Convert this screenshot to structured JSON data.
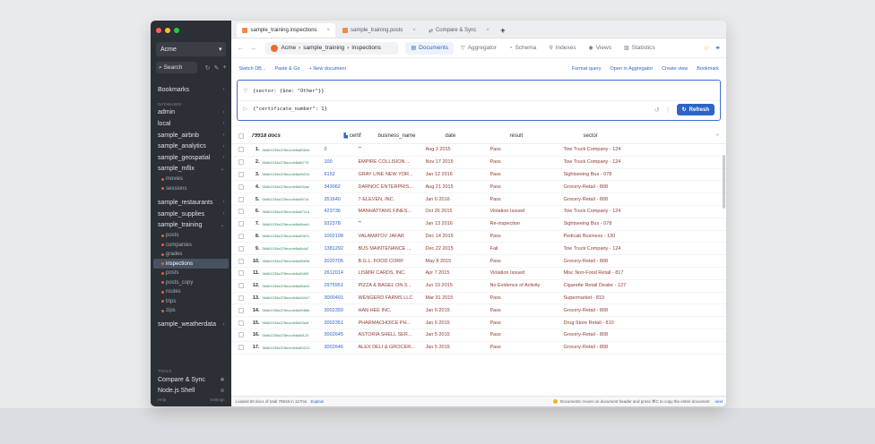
{
  "window": {
    "traffic_colors": [
      "#ff5f57",
      "#febc2e",
      "#28c840"
    ]
  },
  "sidebar": {
    "project": "Acme",
    "search_label": "Search",
    "bookmarks_label": "Bookmarks",
    "databases_label": "DATABASES",
    "tools_label": "TOOLS",
    "footer_help": "Help",
    "footer_settings": "Settings",
    "tree": [
      {
        "label": "admin",
        "children": []
      },
      {
        "label": "local",
        "children": []
      },
      {
        "label": "sample_airbnb",
        "children": []
      },
      {
        "label": "sample_analytics",
        "children": []
      },
      {
        "label": "sample_geospatial",
        "children": []
      },
      {
        "label": "sample_mflix",
        "children": [
          "movies",
          "sessions"
        ]
      },
      {
        "label": "sample_restaurants",
        "children": []
      },
      {
        "label": "sample_supplies",
        "children": []
      },
      {
        "label": "sample_training",
        "children": [
          "posts",
          "companies",
          "grades",
          "inspections",
          "posts",
          "posts_copy",
          "routes",
          "trips",
          "zips"
        ]
      },
      {
        "label": "sample_weatherdata",
        "children": []
      }
    ],
    "active_child": "inspections",
    "tools": [
      "Compare & Sync",
      "Node.js Shell"
    ]
  },
  "tabs": [
    {
      "label": "sample_training.inspections",
      "active": true
    },
    {
      "label": "sample_training.posts",
      "active": false
    },
    {
      "label": "Compare & Sync",
      "active": false
    }
  ],
  "breadcrumb": {
    "project": "Acme",
    "db": "sample_training",
    "collection": "inspections"
  },
  "view_tabs": [
    {
      "label": "Documents",
      "active": true
    },
    {
      "label": "Aggregator",
      "active": false
    },
    {
      "label": "Schema",
      "active": false
    },
    {
      "label": "Indexes",
      "active": false
    },
    {
      "label": "Views",
      "active": false
    },
    {
      "label": "Statistics",
      "active": false
    }
  ],
  "actions_left": [
    "Switch DB...",
    "Paste & Go",
    "+ New document"
  ],
  "actions_right": [
    "Format query",
    "Open in Aggregator",
    "Create view",
    "Bookmark"
  ],
  "query": {
    "filter": "{sector: {$ne: \"Other\"}}",
    "projection": "{\"certificate_number\": 1}",
    "refresh_label": "Refresh"
  },
  "table": {
    "docs_count": "79918 docs",
    "columns": [
      "certif",
      "business_name",
      "date",
      "result",
      "sector"
    ],
    "rows": [
      {
        "n": "1.",
        "id": "56d61033a378eccde8a8083e",
        "cert": "0",
        "name": "\"\"",
        "date": "Aug 3 2015",
        "result": "Pass",
        "sector": "Tow Truck Company - 124"
      },
      {
        "n": "2.",
        "id": "56d61033a378eccde8a8f775",
        "cert": "100",
        "name": "EMPIRE COLLISION ...",
        "date": "Nov 17 2015",
        "result": "Pass",
        "sector": "Tow Truck Company - 124"
      },
      {
        "n": "3.",
        "id": "56d61033a378eccde8a96231",
        "cert": "6152",
        "name": "GRAY LINE NEW YOR...",
        "date": "Jan 12 2016",
        "result": "Pass",
        "sector": "Sightseeing Bus - 078"
      },
      {
        "n": "4.",
        "id": "56d61033a378eccde8a93cac",
        "cert": "343062",
        "name": "DARNOC ENTERPRIS...",
        "date": "Aug 21 2015",
        "result": "Pass",
        "sector": "Grocery-Retail - 808"
      },
      {
        "n": "5.",
        "id": "56d61034a378eccde8a9674f",
        "cert": "351640",
        "name": "7-ELEVEN, INC.",
        "date": "Jan 6 2016",
        "result": "Pass",
        "sector": "Grocery-Retail - 808"
      },
      {
        "n": "6.",
        "id": "56d61033a378eccde8a8711d",
        "cert": "423736",
        "name": "MANHATTANS FINES...",
        "date": "Oct 26 2015",
        "result": "Violation Issued",
        "sector": "Tow Truck Company - 124"
      },
      {
        "n": "7.",
        "id": "56d61033a378eccde8a9bed1",
        "cert": "932378",
        "name": "\"\"",
        "date": "Jan 13 2016",
        "result": "Re-inspection",
        "sector": "Sightseeing Bus - 078"
      },
      {
        "n": "8.",
        "id": "56d61033a378eccde8a8987c",
        "cert": "1002198",
        "name": "VALAMATOV JAFAR",
        "date": "Dec 14 2015",
        "result": "Pass",
        "sector": "Pedicab Business - 130"
      },
      {
        "n": "9.",
        "id": "56d61034a378eccde8a8cfa2",
        "cert": "1381292",
        "name": "BUS MAINTENANCE ...",
        "date": "Dec 22 2015",
        "result": "Fail",
        "sector": "Tow Truck Company - 124"
      },
      {
        "n": "10.",
        "id": "56d61033a378eccde8a85836",
        "cert": "2020705",
        "name": "B.G.L. FOOD CORP.",
        "date": "May 8 2015",
        "result": "Pass",
        "sector": "Grocery-Retail - 808"
      },
      {
        "n": "11.",
        "id": "56d61033a378eccde8a8460f",
        "cert": "2612014",
        "name": "LISMIR CARDS, INC.",
        "date": "Apr 7 2015",
        "result": "Violation Issued",
        "sector": "Misc Non-Food Retail - 817"
      },
      {
        "n": "12.",
        "id": "56d61034a378eccde8a86b42",
        "cert": "2975951",
        "name": "PIZZA & BAGEL ON 3...",
        "date": "Jun 10 2015",
        "result": "No Evidence of Activity",
        "sector": "Cigarette Retail Dealer - 127"
      },
      {
        "n": "13.",
        "id": "56d61033a378eccde8a942d7",
        "cert": "3000491",
        "name": "WENGERD FARMS LLC",
        "date": "Mar 31 2015",
        "result": "Pass",
        "sector": "Supermarket - 819"
      },
      {
        "n": "14.",
        "id": "56d61035a378eccde8a9088b",
        "cert": "3002350",
        "name": "HAN HEE INC.",
        "date": "Jan 6 2015",
        "result": "Pass",
        "sector": "Grocery-Retail - 808"
      },
      {
        "n": "15.",
        "id": "56d61034a378eccde8a93a4f",
        "cert": "3002351",
        "name": "PHARMACHOICE PH...",
        "date": "Jan 6 2015",
        "result": "Pass",
        "sector": "Drug Store Retail - 810"
      },
      {
        "n": "16.",
        "id": "56d61035a378eccde8a8f123",
        "cert": "3002645",
        "name": "ASTORIA SHELL SER...",
        "date": "Jan 5 2015",
        "result": "Pass",
        "sector": "Grocery-Retail - 808"
      },
      {
        "n": "17.",
        "id": "56d61033a378eccde8a80013",
        "cert": "3002646",
        "name": "ALEX DELI & GROCER...",
        "date": "Jan 5 2015",
        "result": "Pass",
        "sector": "Grocery-Retail - 808"
      }
    ]
  },
  "status": {
    "left": "Loaded 50 docs of total 79918 in 117ms.",
    "explain": "Explain",
    "hint": "Documents: Hover on document header and press ⌘C to copy the entire document",
    "next": "next"
  },
  "colors": {
    "accent": "#2e64c9",
    "sidebar_bg": "#2b2f36",
    "string": "#8d3b2f",
    "id": "#2f8a5a"
  }
}
